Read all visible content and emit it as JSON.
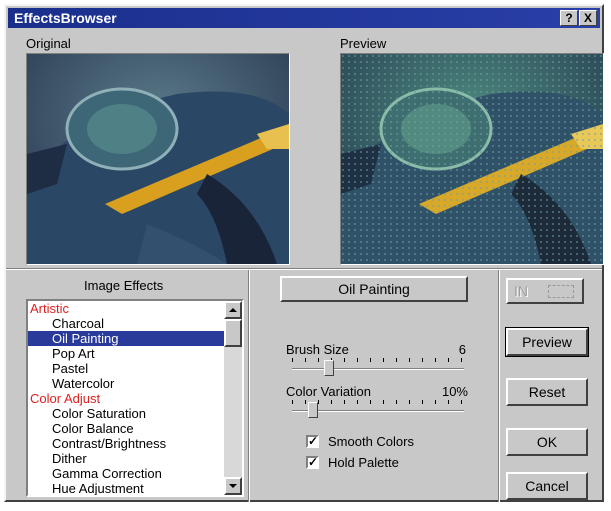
{
  "window": {
    "title": "EffectsBrowser",
    "help_btn": "?",
    "close_btn": "X"
  },
  "images": {
    "original_label": "Original",
    "preview_label": "Preview"
  },
  "effects": {
    "header": "Image Effects",
    "items": [
      {
        "label": "Artistic",
        "kind": "cat"
      },
      {
        "label": "Charcoal",
        "kind": "item"
      },
      {
        "label": "Oil Painting",
        "kind": "item",
        "selected": true
      },
      {
        "label": "Pop Art",
        "kind": "item"
      },
      {
        "label": "Pastel",
        "kind": "item"
      },
      {
        "label": "Watercolor",
        "kind": "item"
      },
      {
        "label": "Color Adjust",
        "kind": "cat"
      },
      {
        "label": "Color Saturation",
        "kind": "item"
      },
      {
        "label": "Color Balance",
        "kind": "item"
      },
      {
        "label": "Contrast/Brightness",
        "kind": "item"
      },
      {
        "label": "Dither",
        "kind": "item"
      },
      {
        "label": "Gamma Correction",
        "kind": "item"
      },
      {
        "label": "Hue Adjustment",
        "kind": "item"
      }
    ]
  },
  "settings": {
    "effect_name": "Oil Painting",
    "brush_size": {
      "label": "Brush Size",
      "value": "6",
      "level": 0.2
    },
    "color_variation": {
      "label": "Color Variation",
      "value": "10%",
      "level": 0.1
    },
    "smooth_colors": {
      "label": "Smooth Colors",
      "checked": true
    },
    "hold_palette": {
      "label": "Hold Palette",
      "checked": true
    }
  },
  "buttons": {
    "in_out": "IN",
    "preview": "Preview",
    "reset": "Reset",
    "ok": "OK",
    "cancel": "Cancel"
  },
  "colors": {
    "title_bg": "#1a2f8c",
    "selection": "#2a3a9a",
    "category": "#e02020"
  }
}
